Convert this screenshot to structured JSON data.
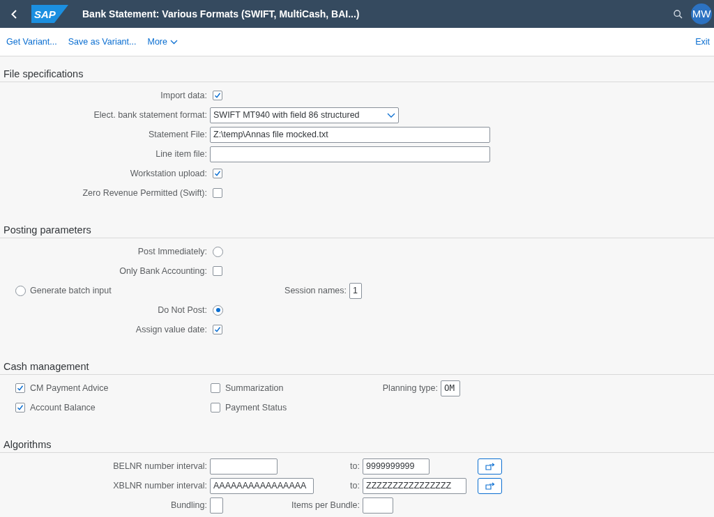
{
  "shell": {
    "logo": "SAP",
    "title": "Bank Statement: Various Formats (SWIFT, MultiCash, BAI...)",
    "user_initials": "MW"
  },
  "toolbar": {
    "actions": [
      {
        "label": "Get Variant..."
      },
      {
        "label": "Save as Variant..."
      }
    ],
    "more": "More",
    "exit": "Exit"
  },
  "file_specifications": {
    "title": "File specifications",
    "rows": [
      {
        "kind": "checkbox",
        "label": "Import data:",
        "checked": true
      },
      {
        "kind": "dropdown",
        "label": "Elect. bank statement format:",
        "value": "SWIFT MT940 with field 86 structured"
      },
      {
        "kind": "input",
        "label": "Statement File:",
        "value": "Z:\\temp\\Annas file mocked.txt"
      },
      {
        "kind": "input",
        "label": "Line item file:"
      },
      {
        "kind": "checkbox",
        "label": "Workstation upload:",
        "checked": true
      },
      {
        "kind": "checkbox",
        "label": "Zero Revenue Permitted (Swift):",
        "checked": false
      }
    ]
  },
  "posting_parameters": {
    "title": "Posting parameters",
    "rows": [
      {
        "kind": "radio",
        "label": "Post Immediately:",
        "selected": false
      },
      {
        "kind": "checkbox",
        "label": "Only Bank Accounting:",
        "checked": false
      },
      {
        "kind": "radio_left",
        "label": "Generate batch input",
        "selected": false,
        "field_label": "Session names:",
        "field_value": "1"
      },
      {
        "kind": "radio",
        "label": "Do Not Post:",
        "selected": true
      },
      {
        "kind": "checkbox",
        "label": "Assign value date:",
        "checked": true
      }
    ]
  },
  "cash_management": {
    "title": "Cash management",
    "rows": [
      {
        "items": [
          {
            "label": "CM Payment Advice",
            "checked": true
          },
          {
            "label": "Summarization",
            "checked": false
          }
        ]
      },
      {
        "items": [
          {
            "label": "Account Balance",
            "checked": true
          },
          {
            "label": "Payment Status",
            "checked": false
          }
        ]
      }
    ],
    "planning_type": {
      "label": "Planning type:",
      "value": "OM"
    }
  },
  "algorithms": {
    "title": "Algorithms",
    "intervals": [
      {
        "label": "BELNR number interval:",
        "to_label": "to:",
        "to": "9999999999"
      },
      {
        "label": "XBLNR number interval:",
        "from": "AAAAAAAAAAAAAAAA",
        "to_label": "to:",
        "to": "ZZZZZZZZZZZZZZZZ"
      }
    ],
    "bundling": {
      "label": "Bundling:"
    },
    "items_per_bundle": {
      "label": "Items per Bundle:"
    }
  }
}
